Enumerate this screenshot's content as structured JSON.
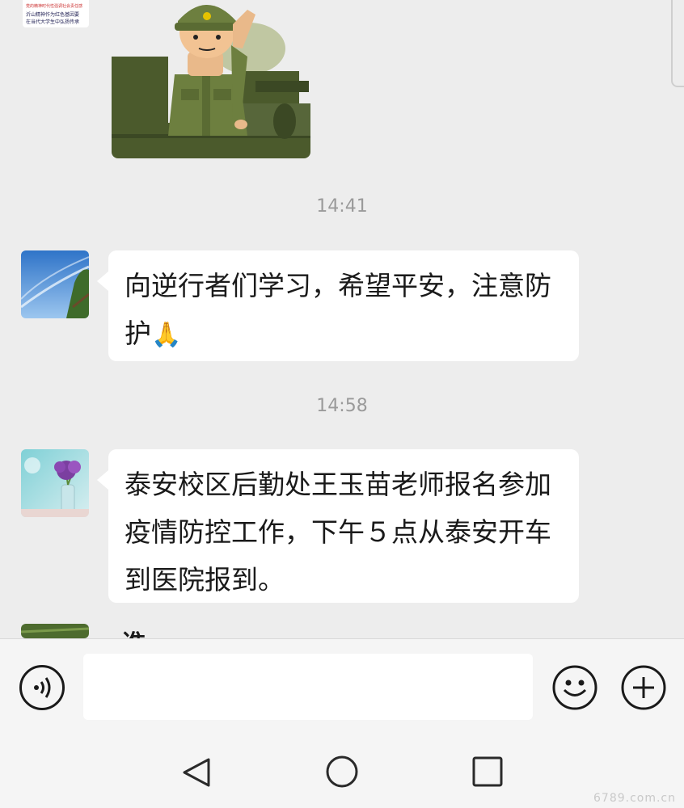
{
  "thumbnail_top": {
    "line1": "党的精神时代性强调社会责任感",
    "line2": "沂山精神作为红色基因要",
    "line3": "在当代大学生中弘扬传承"
  },
  "messages": [
    {
      "time": "14:41",
      "text": "向逆行者们学习，希望平安，注意防护",
      "emoji": "🙏"
    },
    {
      "time": "14:58",
      "text": "泰安校区后勤处王玉苗老师报名参加疫情防控工作，下午５点从泰安开车到医院报到。"
    }
  ],
  "partial_sender": "谯",
  "input": {
    "placeholder": ""
  },
  "icons": {
    "voice": "voice-input-icon",
    "emoji": "emoji-icon",
    "more": "plus-icon",
    "back": "back-icon",
    "home": "home-icon",
    "recent": "recent-apps-icon"
  },
  "watermark": "6789.com.cn",
  "colors": {
    "background": "#ededed",
    "bubble": "#ffffff",
    "time": "#9a9a9a",
    "bar": "#f5f5f5"
  }
}
